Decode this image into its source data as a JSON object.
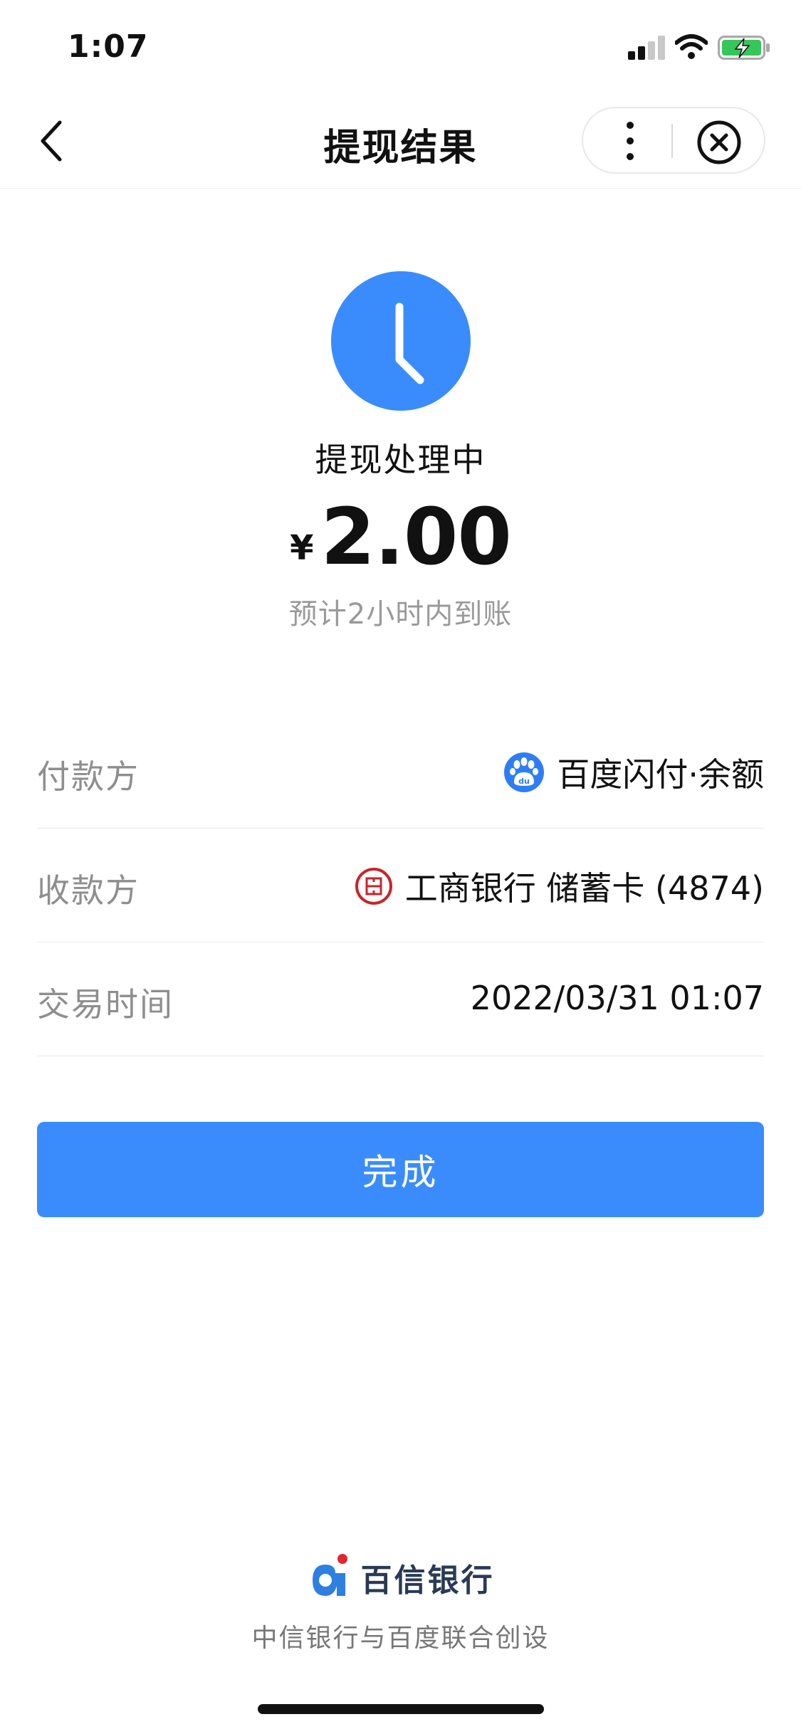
{
  "status_bar": {
    "time": "1:07"
  },
  "nav": {
    "title": "提现结果"
  },
  "result": {
    "status_text": "提现处理中",
    "currency_symbol": "¥",
    "amount": "2.00",
    "eta": "预计2小时内到账",
    "accent_color": "#3a8cfc"
  },
  "details": {
    "payer": {
      "label": "付款方",
      "value": "百度闪付·余额",
      "icon": "baidu-paw-icon"
    },
    "payee": {
      "label": "收款方",
      "value": "工商银行 储蓄卡 (4874)",
      "icon": "icbc-logo-icon"
    },
    "time": {
      "label": "交易时间",
      "value": "2022/03/31 01:07"
    }
  },
  "actions": {
    "done_label": "完成"
  },
  "footer": {
    "brand": "百信银行",
    "tagline": "中信银行与百度联合创设"
  }
}
